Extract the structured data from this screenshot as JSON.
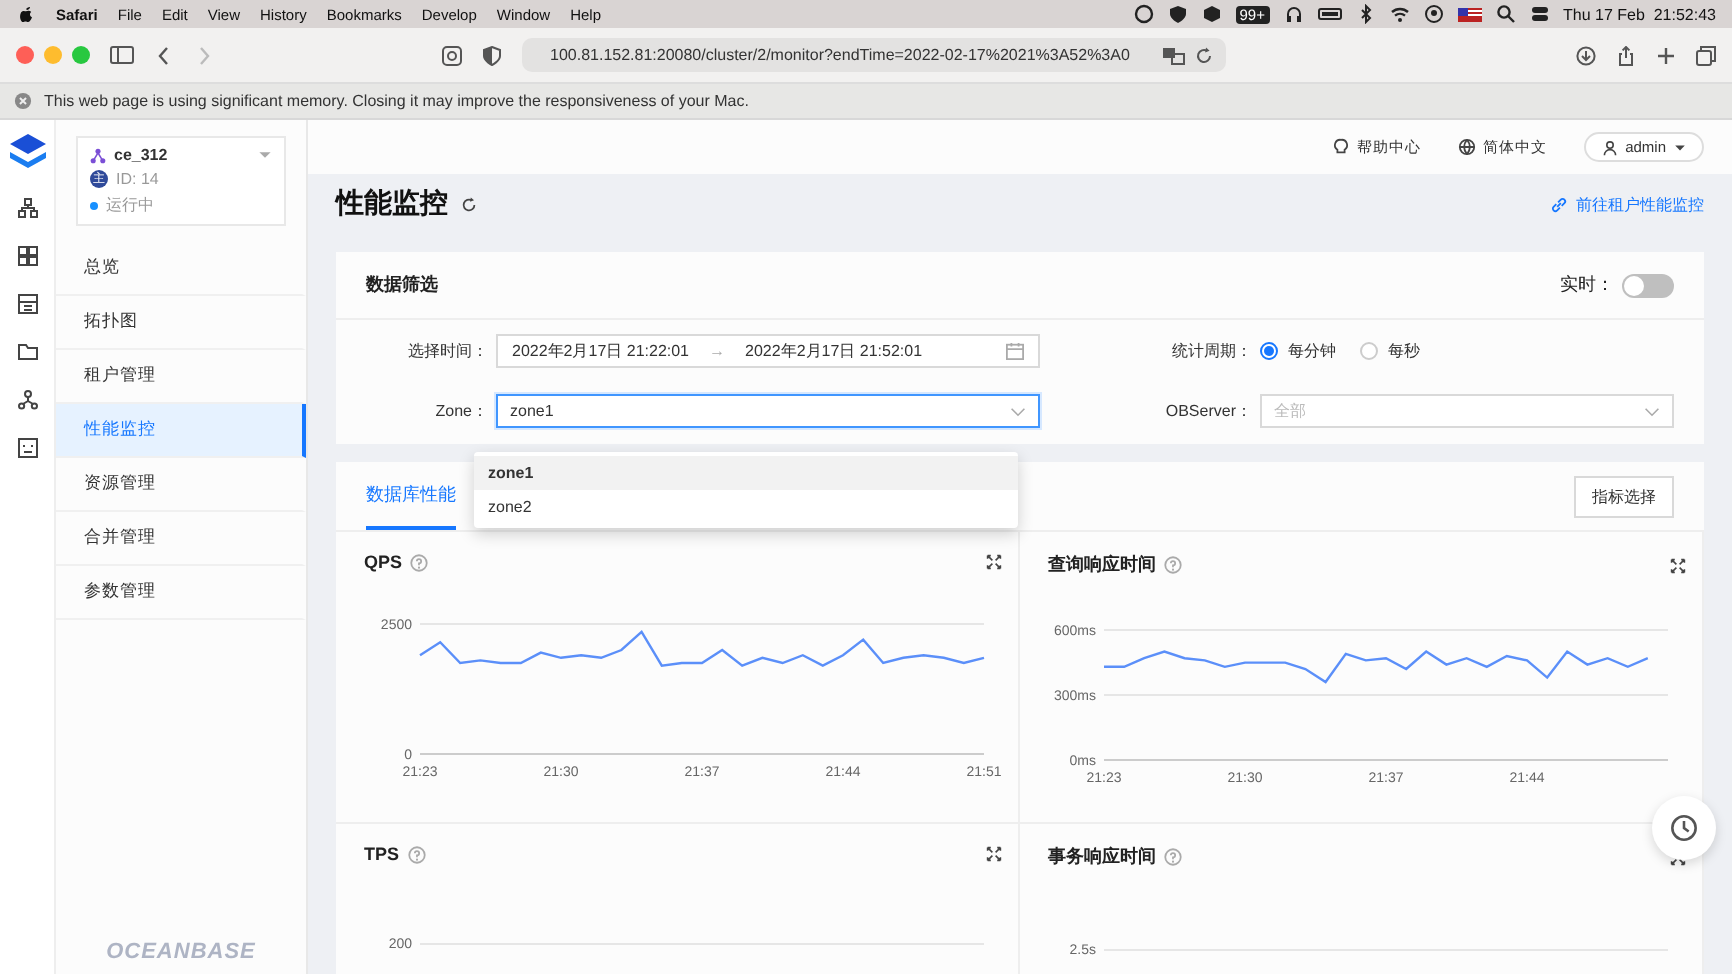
{
  "menubar": {
    "items": [
      {
        "label": "Safari",
        "kind": "app"
      },
      {
        "label": "File",
        "kind": "menu"
      },
      {
        "label": "Edit",
        "kind": "menu"
      },
      {
        "label": "View",
        "kind": "menu"
      },
      {
        "label": "History",
        "kind": "menu"
      },
      {
        "label": "Bookmarks",
        "kind": "menu"
      },
      {
        "label": "Develop",
        "kind": "menu"
      },
      {
        "label": "Window",
        "kind": "menu"
      },
      {
        "label": "Help",
        "kind": "menu"
      }
    ],
    "badge": "99+",
    "clock": "Thu 17 Feb  21:52:43"
  },
  "browser": {
    "url": "100.81.152.81:20080/cluster/2/monitor?endTime=2022-02-17%2021%3A52%3A0"
  },
  "memory_warning": "This web page is using significant memory. Closing it may improve the responsiveness of your Mac.",
  "cluster": {
    "name": "ce_312",
    "role": "主",
    "id": "ID: 14",
    "status": "运行中"
  },
  "nav": [
    {
      "label": "总览",
      "selected": false
    },
    {
      "label": "拓扑图",
      "selected": false
    },
    {
      "label": "租户管理",
      "selected": false
    },
    {
      "label": "性能监控",
      "selected": true
    },
    {
      "label": "资源管理",
      "selected": false
    },
    {
      "label": "合并管理",
      "selected": false
    },
    {
      "label": "参数管理",
      "selected": false
    }
  ],
  "brand": "OCEANBASE",
  "header": {
    "help": "帮助中心",
    "language": "简体中文",
    "user": "admin"
  },
  "page": {
    "title": "性能监控",
    "link": "前往租户性能监控"
  },
  "filter": {
    "title": "数据筛选",
    "realtime_label": "实时：",
    "realtime_on": false,
    "time_label": "选择时间：",
    "start": "2022年2月17日 21:22:01",
    "end": "2022年2月17日 21:52:01",
    "range_separator": "→",
    "period_label": "统计周期：",
    "periods": [
      {
        "label": "每分钟",
        "selected": true
      },
      {
        "label": "每秒",
        "selected": false
      }
    ],
    "zone_label": "Zone：",
    "zone_value": "zone1",
    "observer_label": "OBServer：",
    "observer_placeholder": "全部"
  },
  "zone_options": [
    {
      "label": "zone1",
      "selected": true
    },
    {
      "label": "zone2",
      "selected": false
    }
  ],
  "tabs": [
    {
      "label": "数据库性能",
      "selected": true
    }
  ],
  "metric_button": "指标选择",
  "charts": [
    {
      "title": "QPS",
      "chart_data": {
        "type": "line",
        "categories": [
          "21:23",
          null,
          null,
          null,
          null,
          null,
          null,
          "21:30",
          null,
          null,
          null,
          null,
          null,
          null,
          "21:37",
          null,
          null,
          null,
          null,
          null,
          null,
          "21:44",
          null,
          null,
          null,
          null,
          null,
          null,
          "21:51"
        ],
        "series": [
          {
            "color": "#5b8ff9",
            "values": [
              1900,
              2150,
              1750,
              1800,
              1750,
              1750,
              1950,
              1850,
              1900,
              1850,
              2000,
              2350,
              1700,
              1750,
              1750,
              2000,
              1700,
              1850,
              1750,
              1900,
              1700,
              1900,
              2200,
              1750,
              1850,
              1900,
              1850,
              1750,
              1850
            ]
          }
        ],
        "ylim": [
          0,
          2500
        ],
        "yticks": [
          0,
          2500
        ]
      }
    },
    {
      "title": "查询响应时间",
      "chart_data": {
        "type": "line",
        "categories": [
          "21:23",
          null,
          null,
          null,
          null,
          null,
          null,
          "21:30",
          null,
          null,
          null,
          null,
          null,
          null,
          "21:37",
          null,
          null,
          null,
          null,
          null,
          null,
          "21:44",
          null,
          null,
          null,
          null,
          null,
          null,
          null
        ],
        "series": [
          {
            "color": "#5b8ff9",
            "values": [
              430,
              430,
              470,
              500,
              470,
              460,
              430,
              450,
              450,
              450,
              420,
              360,
              490,
              460,
              470,
              420,
              500,
              440,
              470,
              430,
              480,
              460,
              380,
              500,
              440,
              470,
              430,
              470,
              null
            ]
          }
        ],
        "ylim": [
          0,
          600
        ],
        "yticks": [
          {
            "value": 0,
            "label": "0ms"
          },
          {
            "value": 300,
            "label": "300ms"
          },
          {
            "value": 600,
            "label": "600ms"
          }
        ]
      }
    },
    {
      "title": "TPS",
      "top_tick": "200"
    },
    {
      "title": "事务响应时间",
      "top_tick": "2.5s"
    }
  ]
}
